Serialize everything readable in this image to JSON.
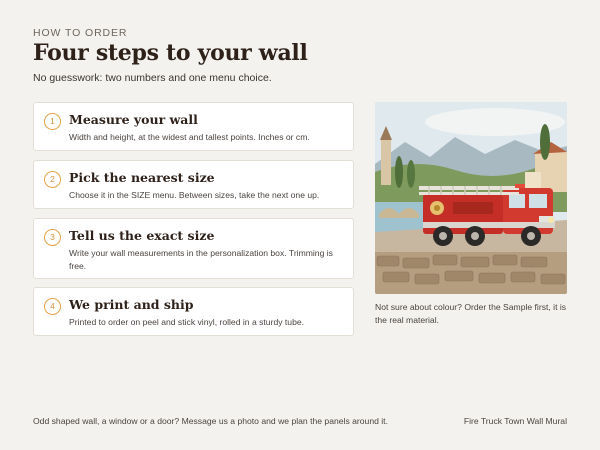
{
  "header": {
    "eyebrow": "HOW TO ORDER",
    "title": "Four steps to your wall",
    "subtitle": "No guesswork: two numbers and one menu choice."
  },
  "steps": [
    {
      "number": "1",
      "title": "Measure your wall",
      "body": "Width and height, at the widest and tallest points. Inches or cm."
    },
    {
      "number": "2",
      "title": "Pick the nearest size",
      "body": "Choose it in the SIZE menu. Between sizes, take the next one up."
    },
    {
      "number": "3",
      "title": "Tell us the exact size",
      "body": "Write your wall measurements in the personalization box. Trimming is free."
    },
    {
      "number": "4",
      "title": "We print and ship",
      "body": "Printed to order on peel and stick vinyl, rolled in a sturdy tube."
    }
  ],
  "aside": {
    "image_subject": "fire-truck-town-illustration",
    "note": "Not sure about colour? Order the Sample first, it is the real material."
  },
  "footer": {
    "left": "Odd shaped wall, a window or a door? Message us a photo and we plan the panels around it.",
    "right": "Fire Truck Town Wall Mural"
  },
  "colors": {
    "background": "#f4f2ee",
    "accent": "#e2a24a",
    "heading": "#2e2119",
    "card": "#ffffff"
  }
}
